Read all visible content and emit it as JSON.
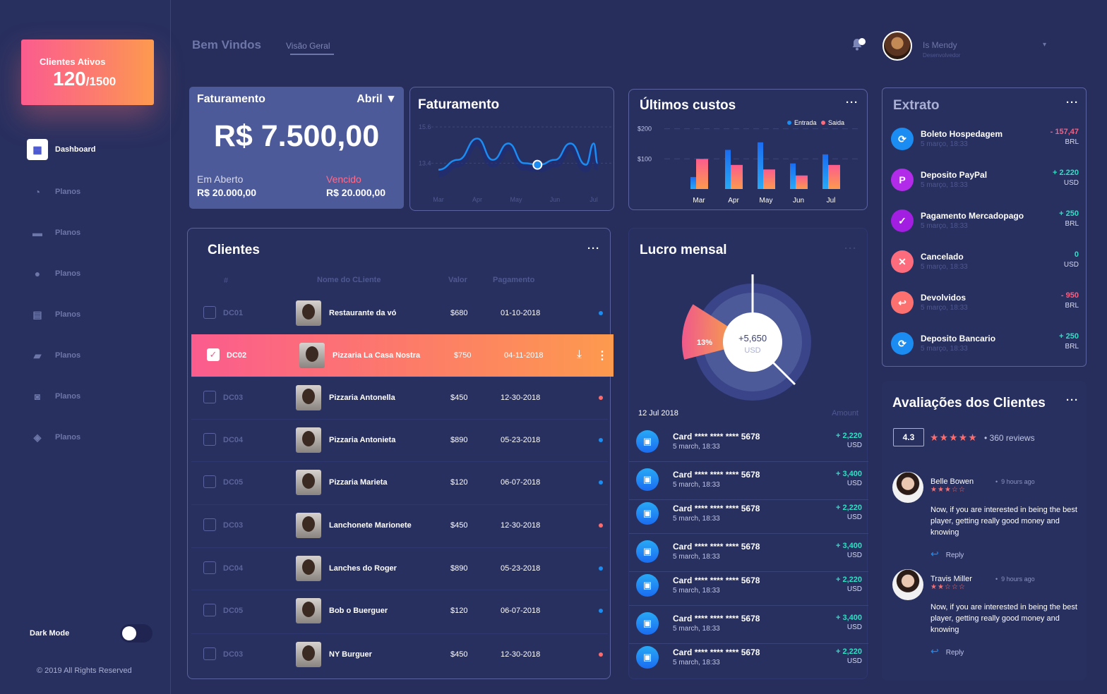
{
  "sidebar": {
    "promo": {
      "label": "Clientes Ativos",
      "count": "120",
      "total": "/1500"
    },
    "nav": [
      {
        "label": "Dashboard",
        "icon": "dashboard-icon"
      },
      {
        "label": "Planos",
        "icon": "pie-chart-icon"
      },
      {
        "label": "Planos",
        "icon": "credit-card-icon"
      },
      {
        "label": "Planos",
        "icon": "coin-icon"
      },
      {
        "label": "Planos",
        "icon": "calendar-icon"
      },
      {
        "label": "Planos",
        "icon": "chat-icon"
      },
      {
        "label": "Planos",
        "icon": "contact-icon"
      },
      {
        "label": "Planos",
        "icon": "layers-icon"
      }
    ],
    "dark_mode_label": "Dark Mode",
    "copyright": "© 2019 All Rights Reserved"
  },
  "header": {
    "title": "Bem Vindos",
    "tab": "Visão Geral",
    "user": {
      "name": "Is Mendy",
      "role": "Desenvolvedor"
    }
  },
  "faturamento_summary": {
    "title": "Faturamento",
    "month": "Abril",
    "amount": "R$ 7.500,00",
    "open_label": "Em Aberto",
    "open_value": "R$ 20.000,00",
    "due_label": "Vencido",
    "due_value": "R$ 20.000,00"
  },
  "faturamento_chart": {
    "title": "Faturamento",
    "y_ticks": [
      "15.6",
      "13.4"
    ],
    "x_ticks": [
      "Mar",
      "Apr",
      "May",
      "Jun",
      "Jul"
    ]
  },
  "custos": {
    "title": "Últimos custos",
    "legend": [
      "Entrada",
      "Saida"
    ],
    "y_ticks": [
      "$200",
      "$100"
    ]
  },
  "chart_data": [
    {
      "type": "line",
      "title": "Faturamento",
      "x": [
        "Mar",
        "Apr",
        "May",
        "Jun",
        "Jul"
      ],
      "series": [
        {
          "values": [
            13.2,
            14.8,
            13.6,
            12.8,
            14.6
          ]
        }
      ],
      "ylim": [
        12.0,
        15.6
      ]
    },
    {
      "type": "bar",
      "title": "Últimos custos",
      "categories": [
        "Mar",
        "Apr",
        "May",
        "Jun",
        "Jul"
      ],
      "series": [
        {
          "name": "Entrada",
          "values": [
            40,
            130,
            155,
            85,
            115
          ]
        },
        {
          "name": "Saida",
          "values": [
            100,
            80,
            65,
            45,
            80
          ]
        }
      ],
      "ylim": [
        0,
        260
      ]
    },
    {
      "type": "pie",
      "title": "Lucro mensal",
      "slices": [
        {
          "label": "13%",
          "value": 13
        },
        {
          "label": "",
          "value": 87
        }
      ],
      "center_value": "+5,650",
      "center_unit": "USD"
    }
  ],
  "clientes": {
    "title": "Clientes",
    "columns": [
      "#",
      "Nome do CLiente",
      "Valor",
      "Pagamento"
    ],
    "rows": [
      {
        "code": "DC01",
        "name": "Restaurante da vó",
        "value": "$680",
        "date": "01-10-2018",
        "status": "blue"
      },
      {
        "code": "DC02",
        "name": "Pizzaria La Casa Nostra",
        "value": "$750",
        "date": "04-11-2018",
        "status": "selected"
      },
      {
        "code": "DC03",
        "name": "Pizzaria Antonella",
        "value": "$450",
        "date": "12-30-2018",
        "status": "red"
      },
      {
        "code": "DC04",
        "name": "Pizzaria Antonieta",
        "value": "$890",
        "date": "05-23-2018",
        "status": "blue"
      },
      {
        "code": "DC05",
        "name": "Pizzaria Marieta",
        "value": "$120",
        "date": "06-07-2018",
        "status": "blue"
      },
      {
        "code": "DC03",
        "name": "Lanchonete Marionete",
        "value": "$450",
        "date": "12-30-2018",
        "status": "red"
      },
      {
        "code": "DC04",
        "name": "Lanches do Roger",
        "value": "$890",
        "date": "05-23-2018",
        "status": "blue"
      },
      {
        "code": "DC05",
        "name": "Bob o Buerguer",
        "value": "$120",
        "date": "06-07-2018",
        "status": "blue"
      },
      {
        "code": "DC03",
        "name": "NY Burguer",
        "value": "$450",
        "date": "12-30-2018",
        "status": "red"
      }
    ]
  },
  "lucro": {
    "title": "Lucro mensal",
    "date": "12 Jul 2018",
    "amount_header": "Amount",
    "transactions": [
      {
        "card": "Card",
        "mask": "**** **** **** 5678",
        "date": "5 march, 18:33",
        "amount": "+ 2,220",
        "cur": "USD"
      },
      {
        "card": "Card",
        "mask": "**** **** **** 5678",
        "date": "5 march, 18:33",
        "amount": "+ 3,400",
        "cur": "USD"
      },
      {
        "card": "Card",
        "mask": "**** **** **** 5678",
        "date": "5 march, 18:33",
        "amount": "+ 2,220",
        "cur": "USD"
      },
      {
        "card": "Card",
        "mask": "**** **** **** 5678",
        "date": "5 march, 18:33",
        "amount": "+ 3,400",
        "cur": "USD"
      },
      {
        "card": "Card",
        "mask": "**** **** **** 5678",
        "date": "5 march, 18:33",
        "amount": "+ 2,220",
        "cur": "USD"
      },
      {
        "card": "Card",
        "mask": "**** **** **** 5678",
        "date": "5 march, 18:33",
        "amount": "+ 3,400",
        "cur": "USD"
      },
      {
        "card": "Card",
        "mask": "**** **** **** 5678",
        "date": "5 march, 18:33",
        "amount": "+ 2,220",
        "cur": "USD"
      }
    ]
  },
  "extrato": {
    "title": "Extrato",
    "items": [
      {
        "name": "Boleto Hospedagem",
        "date": "5 março, 18:33",
        "amount": "- 157,47",
        "cur": "BRL",
        "color": "#1b8cf1",
        "amount_color": "#ff5c7c",
        "icon": "sync-icon"
      },
      {
        "name": "Deposito PayPal",
        "date": "5 março, 18:33",
        "amount": "+ 2.220",
        "cur": "USD",
        "color": "#b22be8",
        "amount_color": "#2ee0c4",
        "icon": "paypal-icon"
      },
      {
        "name": "Pagamento Mercadopago",
        "date": "5 março, 18:33",
        "amount": "+ 250",
        "cur": "BRL",
        "color": "#a21ee0",
        "amount_color": "#2ee0c4",
        "icon": "check-icon"
      },
      {
        "name": "Cancelado",
        "date": "5 março, 18:33",
        "amount": "0",
        "cur": "USD",
        "color": "#fc6c7c",
        "amount_color": "#2ee0c4",
        "icon": "close-icon"
      },
      {
        "name": "Devolvidos",
        "date": "5 março, 18:33",
        "amount": "- 950",
        "cur": "BRL",
        "color": "#fc7070",
        "amount_color": "#ff5c7c",
        "icon": "return-icon"
      },
      {
        "name": "Deposito Bancario",
        "date": "5 março, 18:33",
        "amount": "+ 250",
        "cur": "BRL",
        "color": "#1b8cf1",
        "amount_color": "#2ee0c4",
        "icon": "sync-icon"
      }
    ]
  },
  "avaliacoes": {
    "title": "Avaliações dos Clientes",
    "rating": "4.3",
    "stars": "★★★★★",
    "reviews": "360 reviews",
    "items": [
      {
        "name": "Belle Bowen",
        "time": "9 hours ago",
        "stars": "★★★☆☆",
        "text": "Now, if you are interested in being the best player, getting really good money and knowing",
        "reply": "Reply"
      },
      {
        "name": "Travis Miller",
        "time": "9 hours ago",
        "stars": "★★☆☆☆",
        "text": "Now, if you are interested in being the best player, getting really good money and knowing",
        "reply": "Reply"
      }
    ]
  }
}
